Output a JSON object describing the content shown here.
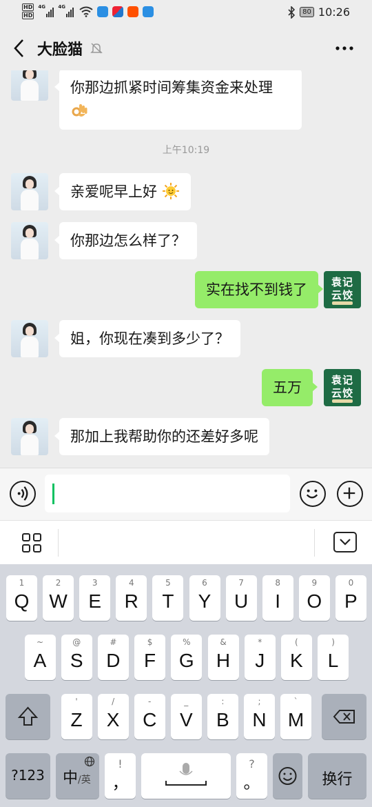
{
  "status": {
    "time": "10:26",
    "battery": "80",
    "signal_tag": "4G",
    "hd": "HD"
  },
  "chat_header": {
    "title": "大脸猫"
  },
  "messages": {
    "m1": {
      "text": "你那边抓紧时间筹集资金来处理",
      "emoji": "ok-hand"
    },
    "timestamp": "上午10:19",
    "m2": {
      "text": "亲爱呢早上好",
      "emoji": "sun"
    },
    "m3": {
      "text": "你那边怎么样了？"
    },
    "m4": {
      "text": "实在找不到钱了"
    },
    "m5": {
      "text": "姐，你现在凑到多少了？"
    },
    "m6": {
      "text": "五万"
    },
    "m7": {
      "text": "那加上我帮助你的还差好多呢"
    }
  },
  "brand_avatar": {
    "line1": "袁记",
    "line2": "云饺"
  },
  "keyboard": {
    "row1": [
      {
        "n": "1",
        "c": "Q"
      },
      {
        "n": "2",
        "c": "W"
      },
      {
        "n": "3",
        "c": "E"
      },
      {
        "n": "4",
        "c": "R"
      },
      {
        "n": "5",
        "c": "T"
      },
      {
        "n": "6",
        "c": "Y"
      },
      {
        "n": "7",
        "c": "U"
      },
      {
        "n": "8",
        "c": "I"
      },
      {
        "n": "9",
        "c": "O"
      },
      {
        "n": "0",
        "c": "P"
      }
    ],
    "row2": [
      {
        "n": "~",
        "c": "A"
      },
      {
        "n": "@",
        "c": "S"
      },
      {
        "n": "#",
        "c": "D"
      },
      {
        "n": "$",
        "c": "F"
      },
      {
        "n": "%",
        "c": "G"
      },
      {
        "n": "&",
        "c": "H"
      },
      {
        "n": "*",
        "c": "J"
      },
      {
        "n": "(",
        "c": "K"
      },
      {
        "n": ")",
        "c": "L"
      }
    ],
    "row3": [
      {
        "n": "'",
        "c": "Z"
      },
      {
        "n": "/",
        "c": "X"
      },
      {
        "n": "-",
        "c": "C"
      },
      {
        "n": "_",
        "c": "V"
      },
      {
        "n": ":",
        "c": "B"
      },
      {
        "n": ";",
        "c": "N"
      },
      {
        "n": "`",
        "c": "M"
      }
    ],
    "numbers_label": "?123",
    "lang_label": "中",
    "lang_alt": "/英",
    "comma_top": "!",
    "comma": "，",
    "period_top": "?",
    "period": "。",
    "enter_label": "换行"
  }
}
